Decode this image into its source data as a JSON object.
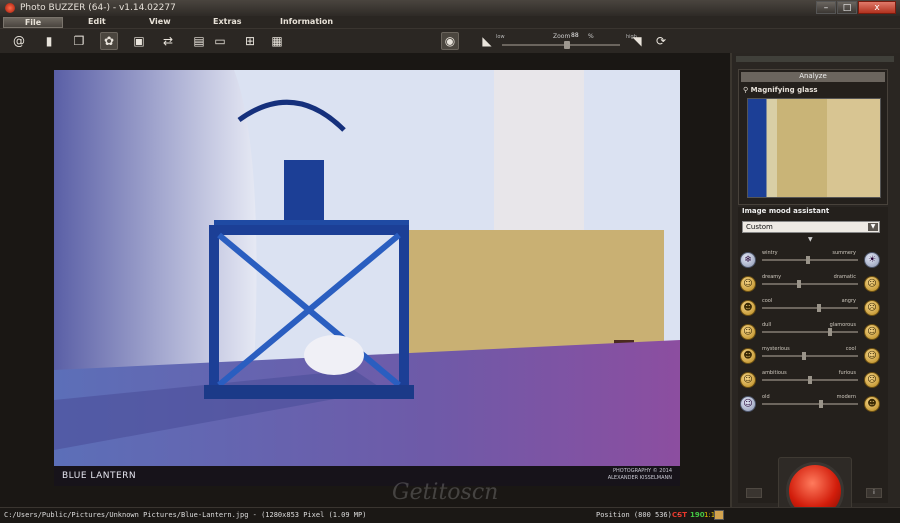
{
  "window": {
    "title": "Photo BUZZER (64-)  -  v1.14.02277",
    "minimize_glyph": "–",
    "maximize_glyph": "□",
    "close_glyph": "x"
  },
  "menu": {
    "file": "File",
    "edit": "Edit",
    "view": "View",
    "extras": "Extras",
    "information": "Information"
  },
  "toolbar": {
    "icons": [
      "at-icon",
      "new-document-icon",
      "copy-icon",
      "puzzle-icon",
      "save-icon",
      "convert-icon",
      "layers-icon",
      "print-icon",
      "crop-icon",
      "histogram-icon",
      "fingerprint-icon",
      "fit-left-icon",
      "fit-right-icon",
      "refresh-icon"
    ],
    "zoom_low": "low",
    "zoom_label": "Zoom",
    "zoom_value": "88",
    "zoom_unit": "%",
    "zoom_high": "high",
    "zoom_level_percent": 88
  },
  "photo": {
    "title": "BLUE LANTERN",
    "credit_line1": "PHOTOGRAPHY © 2014",
    "credit_line2": "ALEXANDER KISSELMANN"
  },
  "sidebar": {
    "analyze_tab": "Analyze",
    "magnify_title": "Magnifying glass",
    "mood_title": "Image mood assistant",
    "mood_selected": "Custom",
    "moods": [
      {
        "left": "wintry",
        "right": "summery",
        "value": 0.48
      },
      {
        "left": "dreamy",
        "right": "dramatic",
        "value": 0.38
      },
      {
        "left": "cool",
        "right": "angry",
        "value": 0.6
      },
      {
        "left": "dull",
        "right": "glamorous",
        "value": 0.72
      },
      {
        "left": "mysterious",
        "right": "cool",
        "value": 0.44
      },
      {
        "left": "ambitious",
        "right": "furious",
        "value": 0.5
      },
      {
        "left": "old",
        "right": "modern",
        "value": 0.62
      }
    ]
  },
  "status": {
    "path": "C:/Users/Public/Pictures/Unknown Pictures/Blue-Lantern.jpg - (1280x853 Pixel (1.09 MP)",
    "position": "Position  (800 536) -",
    "cst": "CST",
    "value190": "190",
    "value11": "1:1"
  },
  "watermark": "Getitoscn"
}
